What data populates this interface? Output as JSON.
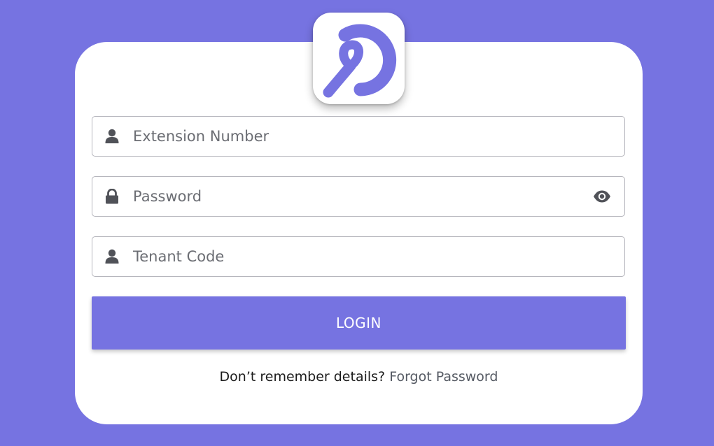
{
  "colors": {
    "background": "#7673e1",
    "accent": "#7673e1",
    "card": "#ffffff",
    "icon": "#505258"
  },
  "logo": {
    "icon": "brand-logo-icon"
  },
  "form": {
    "extension": {
      "placeholder": "Extension Number",
      "icon": "user-icon",
      "value": ""
    },
    "password": {
      "placeholder": "Password",
      "icon": "lock-icon",
      "toggle_icon": "eye-icon",
      "value": ""
    },
    "tenant": {
      "placeholder": "Tenant Code",
      "icon": "user-icon",
      "value": ""
    },
    "login_label": "LOGIN"
  },
  "footer": {
    "prompt": "Don’t remember details?",
    "link": "Forgot Password"
  }
}
